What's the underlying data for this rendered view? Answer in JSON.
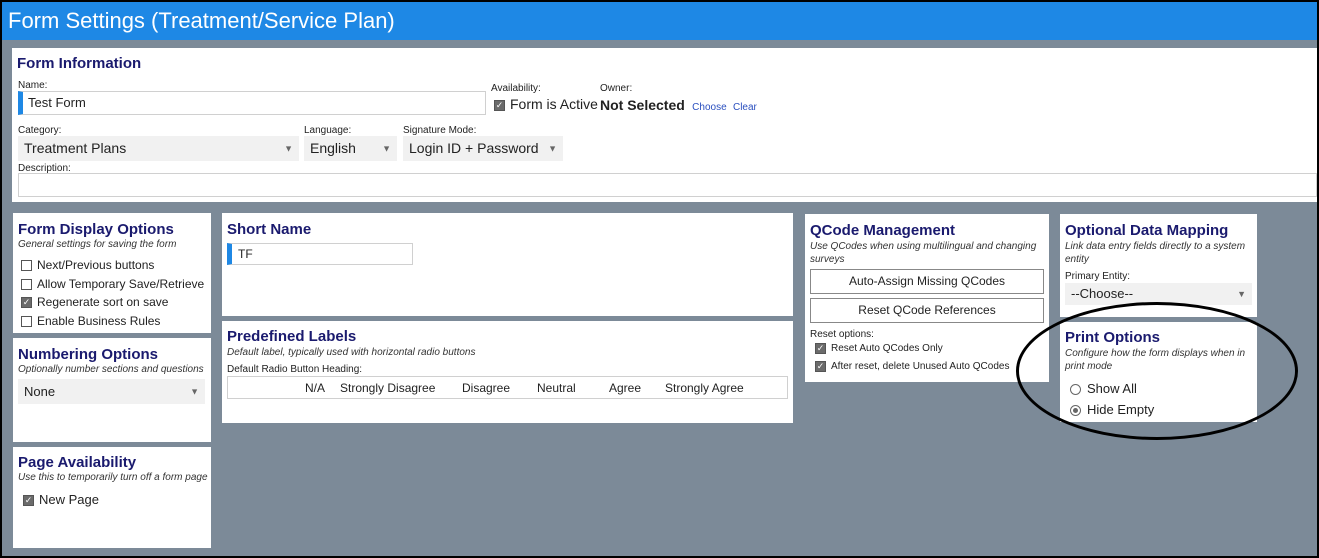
{
  "window": {
    "title": "Form Settings (Treatment/Service Plan)"
  },
  "form_information": {
    "heading": "Form Information",
    "name_label": "Name:",
    "name_value": "Test Form",
    "availability_label": "Availability:",
    "availability_checkbox": "Form is Active",
    "owner_label": "Owner:",
    "owner_value": "Not Selected",
    "owner_choose": "Choose",
    "owner_clear": "Clear",
    "category_label": "Category:",
    "category_value": "Treatment Plans",
    "language_label": "Language:",
    "language_value": "English",
    "signature_label": "Signature Mode:",
    "signature_value": "Login ID + Password",
    "description_label": "Description:",
    "description_value": ""
  },
  "form_display_options": {
    "heading": "Form Display Options",
    "subtitle": "General settings for saving the form",
    "options": [
      {
        "label": "Next/Previous buttons",
        "checked": false
      },
      {
        "label": "Allow Temporary Save/Retrieve",
        "checked": false
      },
      {
        "label": "Regenerate sort on save",
        "checked": true
      },
      {
        "label": "Enable Business Rules",
        "checked": false
      }
    ]
  },
  "numbering_options": {
    "heading": "Numbering Options",
    "subtitle": "Optionally number sections and questions",
    "value": "None"
  },
  "page_availability": {
    "heading": "Page Availability",
    "subtitle": "Use this to temporarily turn off a form page",
    "checkbox": "New Page",
    "checked": true
  },
  "short_name": {
    "heading": "Short Name",
    "value": "TF"
  },
  "predefined_labels": {
    "heading": "Predefined Labels",
    "subtitle": "Default label, typically used with horizontal radio buttons",
    "field_label": "Default Radio Button Heading:",
    "labels": [
      "N/A",
      "Strongly Disagree",
      "Disagree",
      "Neutral",
      "Agree",
      "Strongly Agree"
    ]
  },
  "qcode_management": {
    "heading": "QCode Management",
    "subtitle": "Use QCodes when using multilingual and changing surveys",
    "auto_assign_button": "Auto-Assign Missing QCodes",
    "reset_button": "Reset QCode References",
    "reset_options_label": "Reset options:",
    "reset_options": [
      {
        "label": "Reset Auto QCodes Only",
        "checked": true
      },
      {
        "label": "After reset, delete Unused Auto QCodes",
        "checked": true
      }
    ]
  },
  "optional_data_mapping": {
    "heading": "Optional Data Mapping",
    "subtitle": "Link data entry fields directly to a system entity",
    "entity_label": "Primary Entity:",
    "entity_value": "--Choose--"
  },
  "print_options": {
    "heading": "Print Options",
    "subtitle": "Configure how the form displays when in print mode",
    "choices": [
      {
        "label": "Show All",
        "selected": false
      },
      {
        "label": "Hide Empty",
        "selected": true
      }
    ]
  }
}
